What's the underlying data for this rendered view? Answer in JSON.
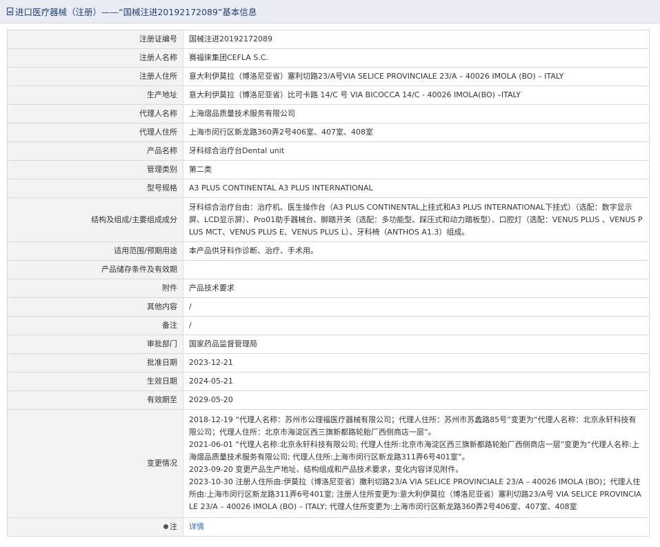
{
  "header": {
    "title": "进口医疗器械（注册）——“国械注进20192172089”基本信息"
  },
  "rows": [
    {
      "key": "注册证编号",
      "value": "国械注进20192172089"
    },
    {
      "key": "注册人名称",
      "value": "赛福徕集团CEFLA S.C."
    },
    {
      "key": "注册人住所",
      "value": "意大利伊莫拉（博洛尼亚省）塞利切路23/A号VIA SELICE PROVINCIALE 23/A – 40026 IMOLA (BO) – ITALY"
    },
    {
      "key": "生产地址",
      "value": "意大利伊莫拉（博洛尼亚省）比可卡路 14/C 号 VIA BICOCCA 14/C - 40026 IMOLA(BO) –ITALY"
    },
    {
      "key": "代理人名称",
      "value": "上海熠品质量技术服务有限公司"
    },
    {
      "key": "代理人住所",
      "value": "上海市闵行区新龙路360弄2号406室、407室、408室"
    },
    {
      "key": "产品名称",
      "value": "牙科综合治疗台Dental unit"
    },
    {
      "key": "管理类别",
      "value": "第二类"
    },
    {
      "key": "型号规格",
      "value": "A3 PLUS CONTINENTAL A3 PLUS INTERNATIONAL"
    },
    {
      "key": "结构及组成/主要组成成分",
      "value": "牙科综合治疗台由：治疗机、医生操作台（A3 PLUS CONTINENTAL上挂式和A3 PLUS INTERNATIONAL下挂式）（选配：数字显示屏、LCD显示屏）、Pro01助手器械台、脚踏开关（选配：多功能型、踩压式和动力踏板型）、口腔灯（选配：VENUS PLUS 、VENUS PLUS MCT、VENUS PLUS E、VENUS PLUS L）、牙科椅（ANTHOS A1.3）组成。"
    },
    {
      "key": "适用范围/预期用途",
      "value": "本产品供牙科作诊断、治疗、手术用。"
    },
    {
      "key": "产品储存条件及有效期",
      "value": ""
    },
    {
      "key": "附件",
      "value": "产品技术要求"
    },
    {
      "key": "其他内容",
      "value": "/"
    },
    {
      "key": "备注",
      "value": "/"
    },
    {
      "key": "审批部门",
      "value": "国家药品监督管理局"
    },
    {
      "key": "批准日期",
      "value": "2023-12-21"
    },
    {
      "key": "生效日期",
      "value": "2024-05-21"
    },
    {
      "key": "有效期至",
      "value": "2029-05-20"
    }
  ],
  "changes": {
    "key": "变更情况",
    "lines": [
      "2018-12-19 “代理人名称：苏州市公理福医疗器械有限公司；代理人住所：苏州市苏蠡路85号”变更为“代理人名称：北京永轩科技有限公司；代理人住所：北京市海淀区西三旗新都路轮胎厂西侧商店一层”。",
      "2021-06-01 “代理人名称:北京永轩科技有限公司; 代理人住所:北京市海淀区西三旗新都路轮胎厂西侧商店一层”变更为“代理人名称:上海熠品质量技术服务有限公司; 代理人住所:上海市闵行区新龙路311弄6号401室”。",
      "2023-09-20 变更产品生产地址、结构组成和产品技术要求，变化内容详见附件。",
      "2023-10-30 注册人住所由:伊莫拉（博洛尼亚省）撒利切路23/A VIA SELICE PROVINCIALE 23/A – 40026 IMOLA (BO)；代理人住所由:上海市闵行区新龙路311弄6号401室; 注册人住所变更为:意大利伊莫拉（博洛尼亚省）塞利切路23/A号 VIA SELICE PROVINCIALE 23/A – 40026 IMOLA (BO) – ITALY; 代理人住所变更为:上海市闵行区新龙路360弄2号406室、407室、408室"
    ]
  },
  "footnote": {
    "key": "注",
    "link_label": "详情",
    "icon": "note-icon"
  }
}
